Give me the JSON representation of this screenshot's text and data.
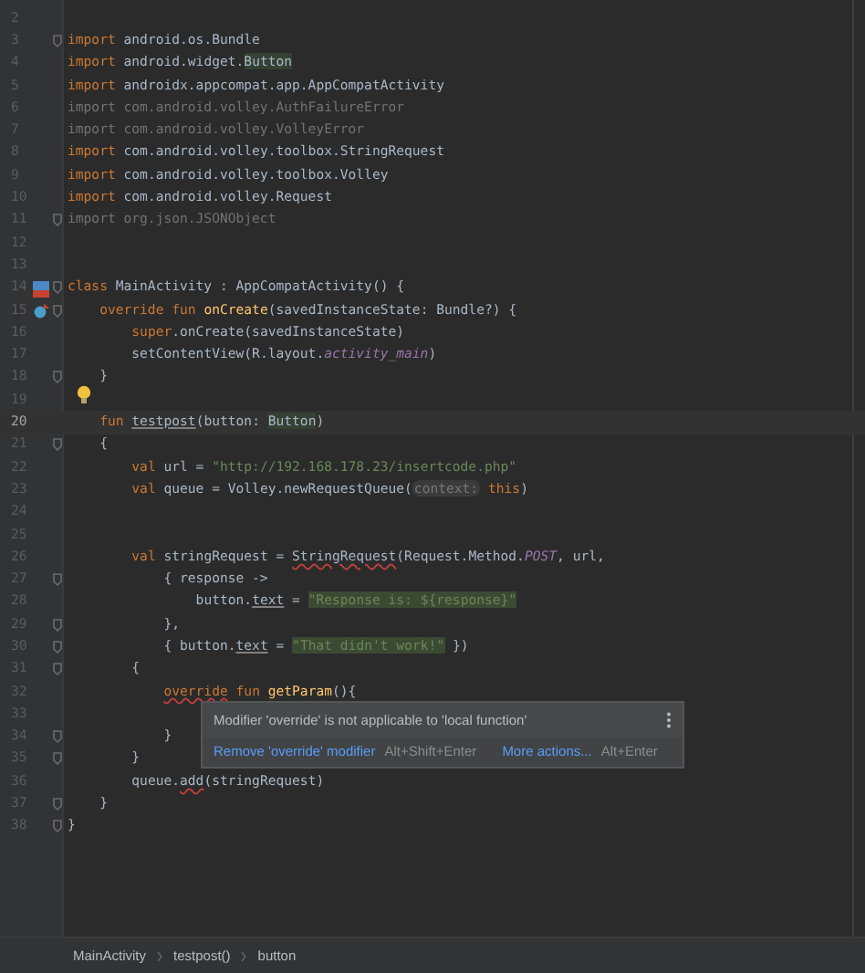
{
  "editor": {
    "lines": [
      {
        "number": "2",
        "current": false,
        "fold": false
      },
      {
        "number": "3",
        "current": false,
        "fold": true,
        "tokens": [
          {
            "t": "import ",
            "kind": "kw"
          },
          {
            "t": "android.os.Bundle",
            "kind": "plain"
          }
        ]
      },
      {
        "number": "4",
        "current": false,
        "fold": false,
        "tokens": [
          {
            "t": "import ",
            "kind": "kw"
          },
          {
            "t": "android.widget.",
            "kind": "plain"
          },
          {
            "t": "Button",
            "kind": "match"
          }
        ]
      },
      {
        "number": "5",
        "current": false,
        "fold": false,
        "tokens": [
          {
            "t": "import ",
            "kind": "kw"
          },
          {
            "t": "androidx.appcompat.app.AppCompatActivity",
            "kind": "plain"
          }
        ]
      },
      {
        "number": "6",
        "current": false,
        "fold": false,
        "tokens": [
          {
            "t": "import com.android.volley.AuthFailureError",
            "kind": "dim"
          }
        ]
      },
      {
        "number": "7",
        "current": false,
        "fold": false,
        "tokens": [
          {
            "t": "import com.android.volley.VolleyError",
            "kind": "dim"
          }
        ]
      },
      {
        "number": "8",
        "current": false,
        "fold": false,
        "tokens": [
          {
            "t": "import ",
            "kind": "kw"
          },
          {
            "t": "com.android.volley.toolbox.StringRequest",
            "kind": "plain"
          }
        ]
      },
      {
        "number": "9",
        "current": false,
        "fold": false,
        "tokens": [
          {
            "t": "import ",
            "kind": "kw"
          },
          {
            "t": "com.android.volley.toolbox.Volley",
            "kind": "plain"
          }
        ]
      },
      {
        "number": "10",
        "current": false,
        "fold": false,
        "tokens": [
          {
            "t": "import ",
            "kind": "kw"
          },
          {
            "t": "com.android.volley.Request",
            "kind": "plain"
          }
        ]
      },
      {
        "number": "11",
        "current": false,
        "fold": true,
        "tokens": [
          {
            "t": "import org.json.JSONObject",
            "kind": "dim"
          }
        ]
      },
      {
        "number": "12",
        "current": false,
        "fold": false
      },
      {
        "number": "13",
        "current": false,
        "fold": false
      },
      {
        "number": "14",
        "current": false,
        "fold": true,
        "gutter_icon": {
          "kind": "class"
        },
        "tokens": [
          {
            "t": "class ",
            "kind": "kw"
          },
          {
            "t": "MainActivity : AppCompatActivity() {",
            "kind": "plain"
          }
        ]
      },
      {
        "number": "15",
        "current": false,
        "fold": true,
        "gutter_icon": {
          "kind": "override"
        },
        "tokens": [
          {
            "t": "    override fun ",
            "kind": "kw"
          },
          {
            "t": "onCreate",
            "kind": "fn"
          },
          {
            "t": "(savedInstanceState: Bundle?) {",
            "kind": "plain"
          }
        ]
      },
      {
        "number": "16",
        "current": false,
        "fold": false,
        "tokens": [
          {
            "t": "        super",
            "kind": "kw"
          },
          {
            "t": ".onCreate(savedInstanceState)",
            "kind": "plain"
          }
        ]
      },
      {
        "number": "17",
        "current": false,
        "fold": false,
        "tokens": [
          {
            "t": "        setContentView(R.layout.",
            "kind": "plain"
          },
          {
            "t": "activity_main",
            "kind": "field"
          },
          {
            "t": ")",
            "kind": "plain"
          }
        ]
      },
      {
        "number": "18",
        "current": false,
        "fold": true,
        "tokens": [
          {
            "t": "    }",
            "kind": "plain"
          }
        ]
      },
      {
        "number": "19",
        "current": false,
        "fold": false,
        "gutter_icon": {
          "kind": "bulb"
        }
      },
      {
        "number": "20",
        "current": true,
        "fold": false,
        "tokens": [
          {
            "t": "    fun ",
            "kind": "kw"
          },
          {
            "t": "testpost",
            "kind": "warn"
          },
          {
            "t": "(button: ",
            "kind": "plain"
          },
          {
            "t": "Button",
            "kind": "match"
          },
          {
            "t": ")",
            "kind": "plain"
          }
        ]
      },
      {
        "number": "21",
        "current": false,
        "fold": true,
        "tokens": [
          {
            "t": "    {",
            "kind": "plain"
          }
        ]
      },
      {
        "number": "22",
        "current": false,
        "fold": false,
        "tokens": [
          {
            "t": "        val ",
            "kind": "kw"
          },
          {
            "t": "url = ",
            "kind": "plain"
          },
          {
            "t": "\"http://192.168.178.23/insertcode.php\"",
            "kind": "str"
          }
        ]
      },
      {
        "number": "23",
        "current": false,
        "fold": false,
        "tokens": [
          {
            "t": "        val ",
            "kind": "kw"
          },
          {
            "t": "queue = Volley.newRequestQueue(",
            "kind": "plain"
          },
          {
            "t": "context:",
            "kind": "hint"
          },
          {
            "t": " this",
            "kind": "kw"
          },
          {
            "t": ")",
            "kind": "plain"
          }
        ]
      },
      {
        "number": "24",
        "current": false,
        "fold": false
      },
      {
        "number": "25",
        "current": false,
        "fold": false
      },
      {
        "number": "26",
        "current": false,
        "fold": false,
        "tokens": [
          {
            "t": "        val ",
            "kind": "kw"
          },
          {
            "t": "stringRequest = ",
            "kind": "plain"
          },
          {
            "t": "StringRequest",
            "kind": "err"
          },
          {
            "t": "(Request.Method.",
            "kind": "plain"
          },
          {
            "t": "POST",
            "kind": "field"
          },
          {
            "t": ", url,",
            "kind": "plain"
          }
        ]
      },
      {
        "number": "27",
        "current": false,
        "fold": true,
        "tokens": [
          {
            "t": "            { response ->",
            "kind": "plain"
          }
        ]
      },
      {
        "number": "28",
        "current": false,
        "fold": false,
        "tokens": [
          {
            "t": "                button.",
            "kind": "plain"
          },
          {
            "t": "text",
            "kind": "warn"
          },
          {
            "t": " = ",
            "kind": "plain"
          },
          {
            "t": "\"Response is: ${response}\"",
            "kind": "strhl"
          }
        ]
      },
      {
        "number": "29",
        "current": false,
        "fold": true,
        "tokens": [
          {
            "t": "            },",
            "kind": "plain"
          }
        ]
      },
      {
        "number": "30",
        "current": false,
        "fold": true,
        "tokens": [
          {
            "t": "            { button.",
            "kind": "plain"
          },
          {
            "t": "text",
            "kind": "warn"
          },
          {
            "t": " = ",
            "kind": "plain"
          },
          {
            "t": "\"That didn't work!\"",
            "kind": "strhl"
          },
          {
            "t": " })",
            "kind": "plain"
          }
        ]
      },
      {
        "number": "31",
        "current": false,
        "fold": true,
        "tokens": [
          {
            "t": "        {",
            "kind": "plain"
          }
        ]
      },
      {
        "number": "32",
        "current": false,
        "fold": false,
        "tokens": [
          {
            "t": "            override",
            "kind": "kwerr"
          },
          {
            "t": " fun ",
            "kind": "kw"
          },
          {
            "t": "getParam",
            "kind": "fn"
          },
          {
            "t": "(){",
            "kind": "plain"
          }
        ]
      },
      {
        "number": "33",
        "current": false,
        "fold": false
      },
      {
        "number": "34",
        "current": false,
        "fold": true,
        "tokens": [
          {
            "t": "            }",
            "kind": "plain"
          }
        ]
      },
      {
        "number": "35",
        "current": false,
        "fold": true,
        "tokens": [
          {
            "t": "        }",
            "kind": "plain"
          }
        ]
      },
      {
        "number": "36",
        "current": false,
        "fold": false,
        "tokens": [
          {
            "t": "        queue.",
            "kind": "plain"
          },
          {
            "t": "add",
            "kind": "err"
          },
          {
            "t": "(stringRequest)",
            "kind": "plain"
          }
        ]
      },
      {
        "number": "37",
        "current": false,
        "fold": true,
        "tokens": [
          {
            "t": "    }",
            "kind": "plain"
          }
        ]
      },
      {
        "number": "38",
        "current": false,
        "fold": true,
        "tokens": [
          {
            "t": "}",
            "kind": "plain"
          }
        ]
      }
    ]
  },
  "popup": {
    "message": "Modifier 'override' is not applicable to 'local function'",
    "actions": [
      {
        "label": "Remove 'override' modifier",
        "shortcut": "Alt+Shift+Enter"
      },
      {
        "label": "More actions...",
        "shortcut": "Alt+Enter"
      }
    ]
  },
  "breadcrumbs": [
    "MainActivity",
    "testpost()",
    "button"
  ]
}
